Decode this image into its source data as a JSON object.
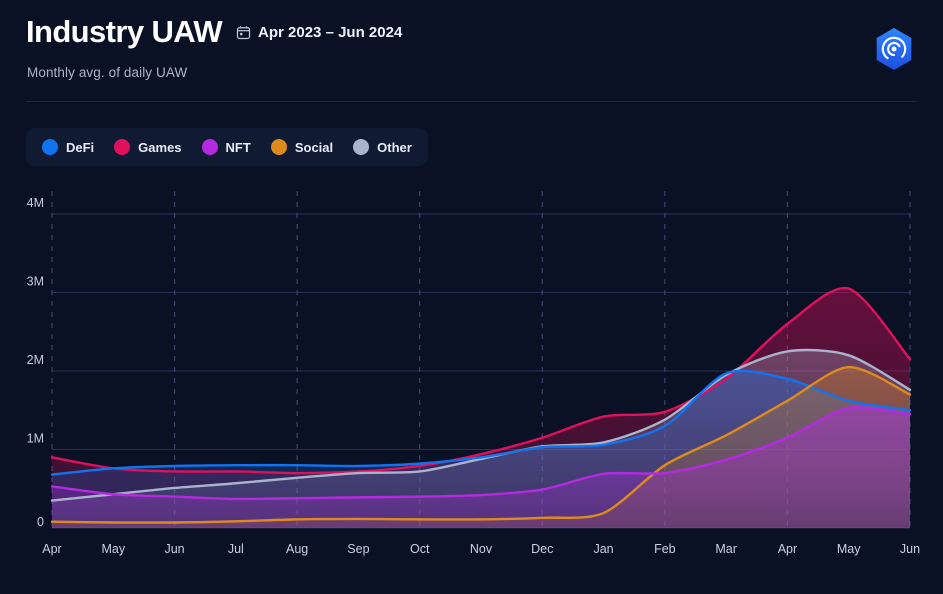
{
  "header": {
    "title": "Industry UAW",
    "date_range": "Apr 2023 – Jun 2024",
    "subtitle": "Monthly avg. of daily UAW",
    "calendar_icon": "calendar-icon",
    "logo_icon": "brand-logo-icon"
  },
  "legend": {
    "items": [
      {
        "label": "DeFi",
        "color": "#1273f0"
      },
      {
        "label": "Games",
        "color": "#e0105c"
      },
      {
        "label": "NFT",
        "color": "#b42ae0"
      },
      {
        "label": "Social",
        "color": "#dd8b1c"
      },
      {
        "label": "Other",
        "color": "#a9b4cc"
      }
    ]
  },
  "chart_data": {
    "type": "area",
    "title": "Industry UAW",
    "subtitle": "Monthly avg. of daily UAW",
    "xlabel": "",
    "ylabel": "",
    "ylim": [
      0,
      4000000
    ],
    "ytick_labels": [
      "0",
      "1M",
      "2M",
      "3M",
      "4M"
    ],
    "ytick_values": [
      0,
      1000000,
      2000000,
      3000000,
      4000000
    ],
    "grid": true,
    "legend_position": "top-left",
    "categories": [
      "Apr",
      "May",
      "Jun",
      "Jul",
      "Aug",
      "Sep",
      "Oct",
      "Nov",
      "Dec",
      "Jan",
      "Feb",
      "Mar",
      "Apr",
      "May",
      "Jun"
    ],
    "series": [
      {
        "name": "DeFi",
        "color": "#1273f0",
        "values": [
          680000,
          760000,
          790000,
          800000,
          800000,
          790000,
          820000,
          900000,
          1030000,
          1060000,
          1300000,
          1970000,
          1900000,
          1620000,
          1500000
        ]
      },
      {
        "name": "Games",
        "color": "#e0105c",
        "values": [
          900000,
          760000,
          720000,
          720000,
          700000,
          720000,
          790000,
          940000,
          1150000,
          1420000,
          1480000,
          1900000,
          2600000,
          3050000,
          2150000
        ]
      },
      {
        "name": "NFT",
        "color": "#b42ae0",
        "values": [
          530000,
          430000,
          400000,
          370000,
          380000,
          390000,
          400000,
          420000,
          490000,
          690000,
          700000,
          870000,
          1150000,
          1530000,
          1450000
        ]
      },
      {
        "name": "Social",
        "color": "#dd8b1c",
        "values": [
          80000,
          70000,
          70000,
          85000,
          110000,
          115000,
          110000,
          110000,
          130000,
          190000,
          800000,
          1180000,
          1620000,
          2050000,
          1700000
        ]
      },
      {
        "name": "Other",
        "color": "#a9b4cc",
        "values": [
          350000,
          430000,
          510000,
          570000,
          640000,
          700000,
          720000,
          880000,
          1040000,
          1090000,
          1380000,
          1950000,
          2250000,
          2200000,
          1760000
        ]
      }
    ]
  }
}
